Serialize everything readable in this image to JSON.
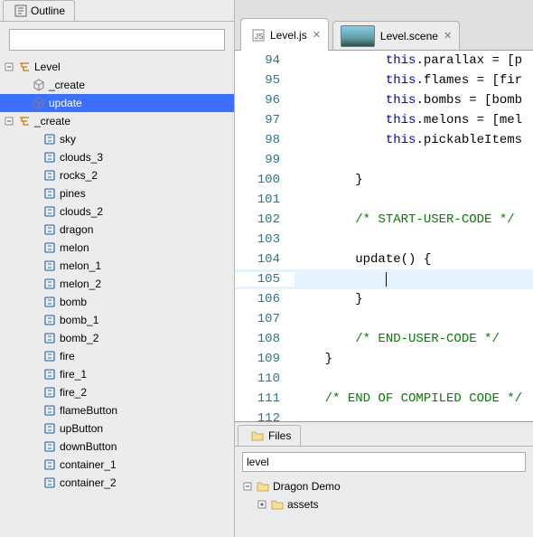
{
  "outline": {
    "tabLabel": "Outline",
    "filterValue": "",
    "tree": [
      {
        "label": "Level",
        "indent": 0,
        "icon": "tree",
        "expand": "minus"
      },
      {
        "label": "_create",
        "indent": 1,
        "icon": "cube",
        "expand": "none"
      },
      {
        "label": "update",
        "indent": 1,
        "icon": "cube",
        "expand": "none",
        "selected": true
      },
      {
        "label": "_create",
        "indent": 0,
        "icon": "tree",
        "expand": "minus"
      },
      {
        "label": "sky",
        "indent": 2,
        "icon": "field",
        "expand": "none"
      },
      {
        "label": "clouds_3",
        "indent": 2,
        "icon": "field",
        "expand": "none"
      },
      {
        "label": "rocks_2",
        "indent": 2,
        "icon": "field",
        "expand": "none"
      },
      {
        "label": "pines",
        "indent": 2,
        "icon": "field",
        "expand": "none"
      },
      {
        "label": "clouds_2",
        "indent": 2,
        "icon": "field",
        "expand": "none"
      },
      {
        "label": "dragon",
        "indent": 2,
        "icon": "field",
        "expand": "none"
      },
      {
        "label": "melon",
        "indent": 2,
        "icon": "field",
        "expand": "none"
      },
      {
        "label": "melon_1",
        "indent": 2,
        "icon": "field",
        "expand": "none"
      },
      {
        "label": "melon_2",
        "indent": 2,
        "icon": "field",
        "expand": "none"
      },
      {
        "label": "bomb",
        "indent": 2,
        "icon": "field",
        "expand": "none"
      },
      {
        "label": "bomb_1",
        "indent": 2,
        "icon": "field",
        "expand": "none"
      },
      {
        "label": "bomb_2",
        "indent": 2,
        "icon": "field",
        "expand": "none"
      },
      {
        "label": "fire",
        "indent": 2,
        "icon": "field",
        "expand": "none"
      },
      {
        "label": "fire_1",
        "indent": 2,
        "icon": "field",
        "expand": "none"
      },
      {
        "label": "fire_2",
        "indent": 2,
        "icon": "field",
        "expand": "none"
      },
      {
        "label": "flameButton",
        "indent": 2,
        "icon": "field",
        "expand": "none"
      },
      {
        "label": "upButton",
        "indent": 2,
        "icon": "field",
        "expand": "none"
      },
      {
        "label": "downButton",
        "indent": 2,
        "icon": "field",
        "expand": "none"
      },
      {
        "label": "container_1",
        "indent": 2,
        "icon": "field",
        "expand": "none"
      },
      {
        "label": "container_2",
        "indent": 2,
        "icon": "field",
        "expand": "none"
      }
    ]
  },
  "editor": {
    "tabs": [
      {
        "label": "Level.js",
        "active": true,
        "icon": "js",
        "closable": true
      },
      {
        "label": "Level.scene",
        "active": false,
        "icon": "scene",
        "closable": true
      }
    ],
    "lines": [
      {
        "n": 94,
        "segs": [
          {
            "t": "            "
          },
          {
            "t": "this",
            "c": "kw-this"
          },
          {
            "t": ".parallax = [p"
          }
        ]
      },
      {
        "n": 95,
        "segs": [
          {
            "t": "            "
          },
          {
            "t": "this",
            "c": "kw-this"
          },
          {
            "t": ".flames = [fir"
          }
        ]
      },
      {
        "n": 96,
        "segs": [
          {
            "t": "            "
          },
          {
            "t": "this",
            "c": "kw-this"
          },
          {
            "t": ".bombs = [bomb"
          }
        ]
      },
      {
        "n": 97,
        "segs": [
          {
            "t": "            "
          },
          {
            "t": "this",
            "c": "kw-this"
          },
          {
            "t": ".melons = [mel"
          }
        ]
      },
      {
        "n": 98,
        "segs": [
          {
            "t": "            "
          },
          {
            "t": "this",
            "c": "kw-this"
          },
          {
            "t": ".pickableItems"
          }
        ]
      },
      {
        "n": 99,
        "segs": [
          {
            "t": ""
          }
        ]
      },
      {
        "n": 100,
        "segs": [
          {
            "t": "        }"
          }
        ]
      },
      {
        "n": 101,
        "segs": [
          {
            "t": ""
          }
        ]
      },
      {
        "n": 102,
        "segs": [
          {
            "t": "        "
          },
          {
            "t": "/* START-USER-CODE */",
            "c": "comment"
          }
        ]
      },
      {
        "n": 103,
        "segs": [
          {
            "t": ""
          }
        ]
      },
      {
        "n": 104,
        "segs": [
          {
            "t": "        update() {"
          }
        ]
      },
      {
        "n": 105,
        "segs": [
          {
            "t": "            "
          }
        ],
        "current": true,
        "cursor": true
      },
      {
        "n": 106,
        "segs": [
          {
            "t": "        }"
          }
        ]
      },
      {
        "n": 107,
        "segs": [
          {
            "t": ""
          }
        ]
      },
      {
        "n": 108,
        "segs": [
          {
            "t": "        "
          },
          {
            "t": "/* END-USER-CODE */",
            "c": "comment"
          }
        ]
      },
      {
        "n": 109,
        "segs": [
          {
            "t": "    }"
          }
        ]
      },
      {
        "n": 110,
        "segs": [
          {
            "t": ""
          }
        ]
      },
      {
        "n": 111,
        "segs": [
          {
            "t": "    "
          },
          {
            "t": "/* END OF COMPILED CODE */",
            "c": "comment"
          }
        ]
      },
      {
        "n": 112,
        "segs": [
          {
            "t": ""
          }
        ]
      }
    ]
  },
  "files": {
    "tabLabel": "Files",
    "filterValue": "level",
    "tree": [
      {
        "label": "Dragon Demo",
        "indent": 0,
        "icon": "folder",
        "expand": "minus"
      },
      {
        "label": "assets",
        "indent": 1,
        "icon": "folder",
        "expand": "plus"
      }
    ]
  }
}
